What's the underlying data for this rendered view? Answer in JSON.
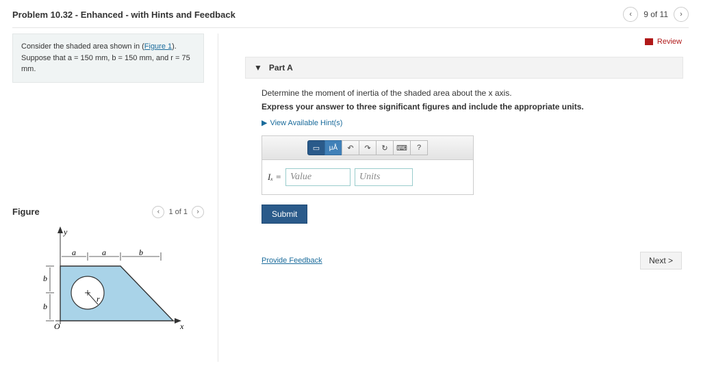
{
  "header": {
    "title": "Problem 10.32 - Enhanced - with Hints and Feedback",
    "pager": "9 of 11"
  },
  "review": "Review",
  "prompt": {
    "pre": "Consider the shaded area shown in (",
    "link": "Figure 1",
    "post": "). Suppose that a = 150 mm, b = 150 mm, and r = 75 mm."
  },
  "figure": {
    "title": "Figure",
    "pager": "1 of 1",
    "labels": {
      "y": "y",
      "x": "x",
      "a": "a",
      "b": "b",
      "r": "r",
      "O": "O"
    }
  },
  "part": {
    "label": "Part A",
    "q1": "Determine the moment of inertia of the shaded area about the x axis.",
    "q2": "Express your answer to three significant figures and include the appropriate units.",
    "hints": "View Available Hint(s)",
    "toolbar": {
      "mu": "μÅ",
      "undo": "↶",
      "redo": "↷",
      "reset": "↻",
      "kbd": "⌨",
      "help": "?"
    },
    "answer": {
      "lhs": "Iₓ =",
      "value_ph": "Value",
      "units_ph": "Units"
    },
    "submit": "Submit"
  },
  "feedback": "Provide Feedback",
  "next": "Next >"
}
